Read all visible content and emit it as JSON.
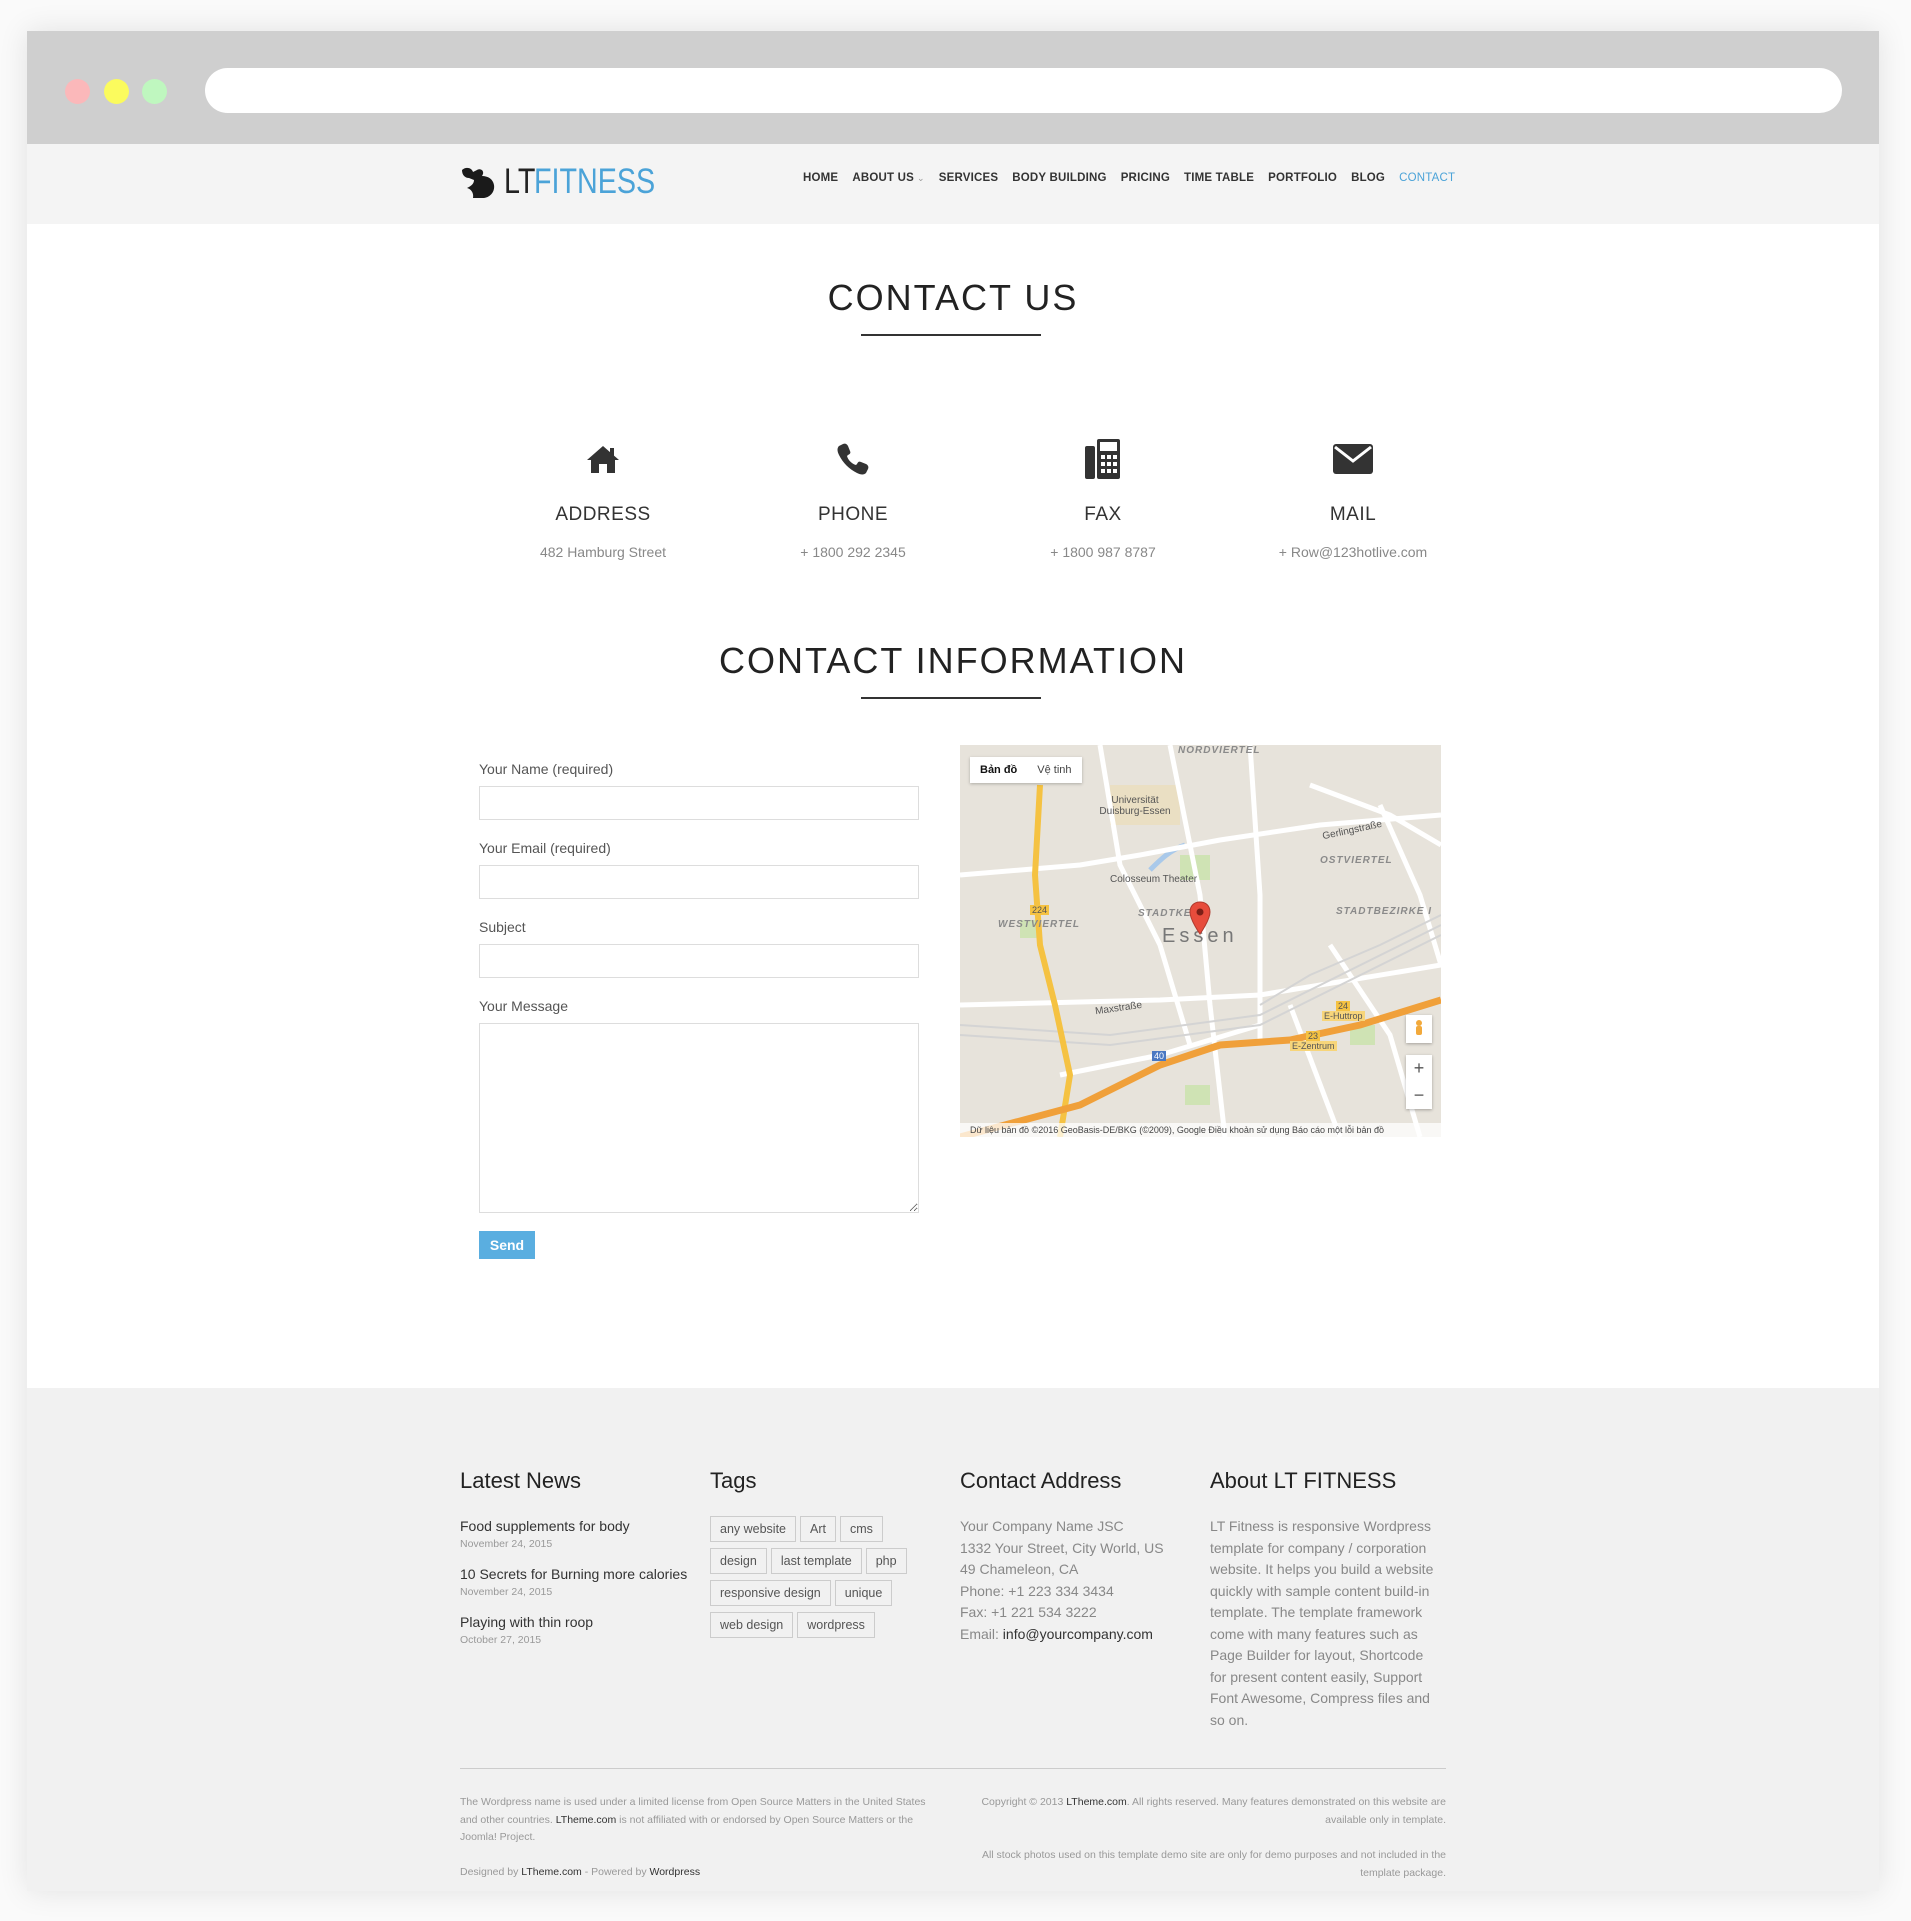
{
  "nav": {
    "logo_lt": "LT",
    "logo_fitness": "FITNESS",
    "items": [
      {
        "label": "HOME"
      },
      {
        "label": "ABOUT US"
      },
      {
        "label": "SERVICES"
      },
      {
        "label": "BODY BUILDING"
      },
      {
        "label": "PRICING"
      },
      {
        "label": "TIME TABLE"
      },
      {
        "label": "PORTFOLIO"
      },
      {
        "label": "BLOG"
      },
      {
        "label": "CONTACT"
      }
    ]
  },
  "contact_us": {
    "title": "CONTACT US",
    "boxes": [
      {
        "icon": "home-icon",
        "label": "ADDRESS",
        "value": "482 Hamburg Street"
      },
      {
        "icon": "phone-icon",
        "label": "PHONE",
        "value": "+ 1800 292 2345"
      },
      {
        "icon": "fax-icon",
        "label": "FAX",
        "value": "+ 1800 987 8787"
      },
      {
        "icon": "envelope-icon",
        "label": "MAIL",
        "value": "+ Row@123hotlive.com"
      }
    ]
  },
  "contact_info": {
    "title": "CONTACT INFORMATION",
    "form": {
      "name_label": "Your Name (required)",
      "email_label": "Your Email (required)",
      "subject_label": "Subject",
      "message_label": "Your Message",
      "name_value": "",
      "email_value": "",
      "subject_value": "",
      "message_value": "",
      "send_label": "Send"
    },
    "map": {
      "tab_map": "Bản đồ",
      "tab_satellite": "Vệ tinh",
      "city": "Essen",
      "labels": {
        "nordviertel": "NORDVIERTEL",
        "universitat": "Universität Duisburg-Essen",
        "gerlingstrasse": "Gerlingstraße",
        "ostviertel": "OSTVIERTEL",
        "colosseum": "Colosseum Theater",
        "stadtkern": "STADTKE",
        "stadtbezirke": "STADTBEZIRKE I",
        "westviertel": "WESTVIERTEL",
        "maxstrasse": "Maxstraße",
        "huttrop": "E-Huttrop",
        "zentrum": "E-Zentrum",
        "road_224": "224",
        "road_40": "40",
        "road_24": "24",
        "road_23": "23"
      },
      "attribution": "Dữ liệu bản đồ ©2016 GeoBasis-DE/BKG (©2009), Google    Điều khoản sử dụng    Báo cáo một lỗi bản đồ",
      "zoom_in": "+",
      "zoom_out": "−"
    }
  },
  "footer": {
    "news": {
      "title": "Latest News",
      "items": [
        {
          "title": "Food supplements for body",
          "date": "November 24, 2015"
        },
        {
          "title": "10 Secrets for Burning more calories",
          "date": "November 24, 2015"
        },
        {
          "title": "Playing with thin roop",
          "date": "October 27, 2015"
        }
      ]
    },
    "tags": {
      "title": "Tags",
      "items": [
        "any website",
        "Art",
        "cms",
        "design",
        "last template",
        "php",
        "responsive design",
        "unique",
        "web design",
        "wordpress"
      ]
    },
    "address": {
      "title": "Contact Address",
      "company": "Your Company Name JSC",
      "street": "1332 Your Street, City World, US",
      "city": "49 Chameleon, CA",
      "phone": "Phone: +1 223 334 3434",
      "fax": "Fax: +1 221 534 3222",
      "email_prefix": "Email: ",
      "email": "info@yourcompany.com"
    },
    "about": {
      "title": "About LT FITNESS",
      "text": "LT Fitness is responsive Wordpress template for company / corporation website. It helps you build a website quickly with sample content build-in template. The template framework come with many features such as Page Builder for layout, Shortcode for present content easily, Support Font Awesome, Compress files and so on."
    },
    "bottom": {
      "license_a": "The Wordpress name is used under a limited license from Open Source Matters in the United States and other countries. ",
      "license_link": "LTheme.com",
      "license_b": " is not affiliated with or endorsed by Open Source Matters or the Joomla! Project.",
      "designed_a": "Designed by ",
      "designed_link": "LTheme.com",
      "designed_b": " - Powered by ",
      "designed_link2": "Wordpress",
      "copyright_a": "Copyright © 2013 ",
      "copyright_link": "LTheme.com",
      "copyright_b": ". All rights reserved. Many features demonstrated on this website are available only in template.",
      "photos": "All stock photos used on this template demo site are only for demo purposes and not included in the template package."
    }
  },
  "colors": {
    "accent": "#4ba3d8",
    "button": "#5aaee0",
    "footer_bg": "#f1f1f1",
    "header_bg": "#f4f4f4",
    "chrome": "#cfcfcf"
  }
}
